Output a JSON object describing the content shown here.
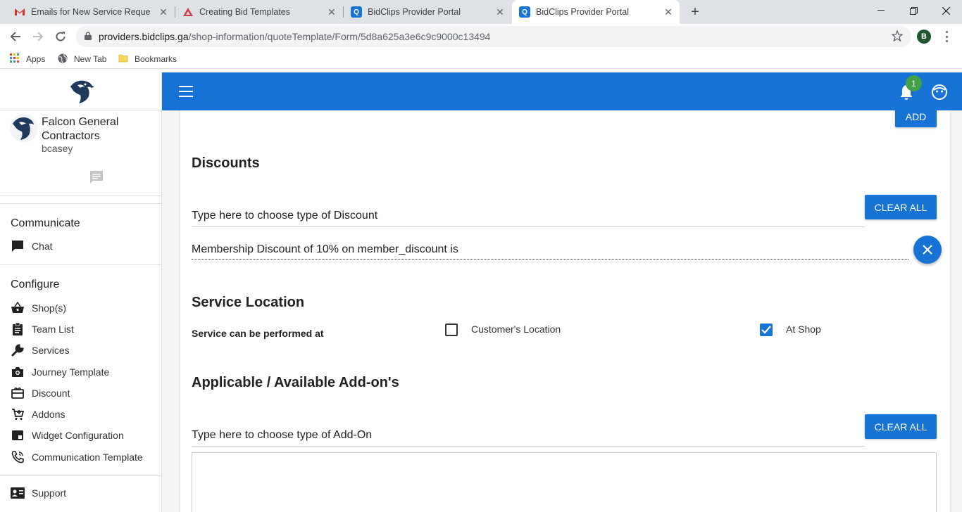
{
  "browser": {
    "tabs": [
      {
        "title": "Emails for New Service Requests",
        "icon": "gmail-icon",
        "active": false
      },
      {
        "title": "Creating Bid Templates",
        "icon": "bidclips-help-icon",
        "active": false
      },
      {
        "title": "BidClips Provider Portal",
        "icon": "bidclips-icon",
        "active": false
      },
      {
        "title": "BidClips Provider Portal",
        "icon": "bidclips-icon",
        "active": true
      }
    ],
    "url_host": "providers.bidclips.ga",
    "url_path": "/shop-information/quoteTemplate/Form/5d8a625a3e6c9c9000c13494",
    "profile_initial": "B",
    "bookmarks": [
      {
        "label": "Apps",
        "icon": "apps-grid-icon"
      },
      {
        "label": "New Tab",
        "icon": "globe-icon"
      },
      {
        "label": "Bookmarks",
        "icon": "folder-icon"
      }
    ]
  },
  "sidebar": {
    "company": "Falcon General Contractors",
    "username": "bcasey",
    "sections": [
      {
        "title": "Communicate",
        "items": [
          {
            "label": "Chat",
            "icon": "chat-icon"
          }
        ]
      },
      {
        "title": "Configure",
        "items": [
          {
            "label": "Shop(s)",
            "icon": "basket-icon"
          },
          {
            "label": "Team List",
            "icon": "clipboard-icon"
          },
          {
            "label": "Services",
            "icon": "wrench-icon"
          },
          {
            "label": "Journey Template",
            "icon": "camera-icon"
          },
          {
            "label": "Discount",
            "icon": "gift-card-icon"
          },
          {
            "label": "Addons",
            "icon": "cart-plus-icon"
          },
          {
            "label": "Widget Configuration",
            "icon": "widget-icon"
          },
          {
            "label": "Communication Template",
            "icon": "phone-icon"
          }
        ]
      }
    ],
    "support": {
      "label": "Support",
      "icon": "contact-card-icon"
    }
  },
  "appbar": {
    "notification_count": "1"
  },
  "form": {
    "add_button": "ADD",
    "discounts": {
      "title": "Discounts",
      "placeholder": "Type here to choose type of Discount",
      "clear_all": "CLEAR ALL",
      "selected": "Membership Discount of 10% on member_discount is"
    },
    "service_location": {
      "title": "Service Location",
      "prompt": "Service can be performed at",
      "options": [
        {
          "label": "Customer's Location",
          "checked": false
        },
        {
          "label": "At Shop",
          "checked": true
        }
      ]
    },
    "addons": {
      "title": "Applicable / Available Add-on's",
      "placeholder": "Type here to choose type of Add-On",
      "clear_all": "CLEAR ALL"
    }
  },
  "colors": {
    "primary": "#1773d6",
    "badge": "#43a047"
  }
}
